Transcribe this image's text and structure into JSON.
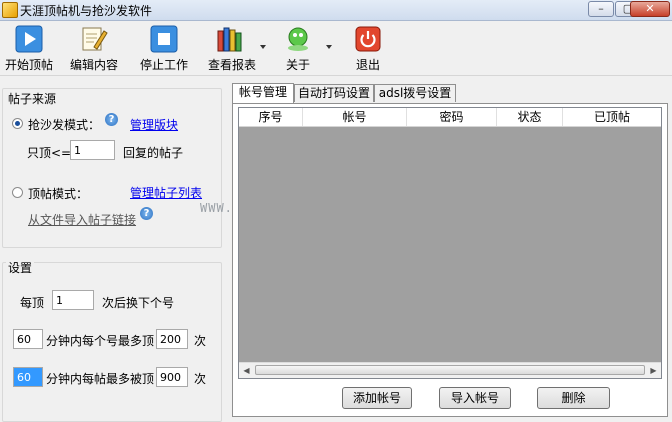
{
  "window": {
    "title": "天涯顶帖机与抢沙发软件",
    "min": "–",
    "max": "▢",
    "close": "✕"
  },
  "toolbar": [
    {
      "label": "开始顶帖",
      "icon": "play-icon"
    },
    {
      "label": "编辑内容",
      "icon": "edit-icon"
    },
    {
      "label": "停止工作",
      "icon": "stop-icon"
    },
    {
      "label": "查看报表",
      "icon": "books-icon"
    },
    {
      "label": "关于",
      "icon": "about-icon"
    },
    {
      "label": "退出",
      "icon": "power-icon"
    }
  ],
  "source": {
    "title": "帖子来源",
    "sofa_mode": "抢沙发模式：",
    "manage_boards": "管理版块",
    "only_top": "只顶<=",
    "only_top_value": "1",
    "replies": "回复的帖子",
    "top_mode": "顶帖模式：",
    "manage_posts": "管理帖子列表",
    "import_link": "从文件导入帖子链接"
  },
  "watermark": "WWW.9UPK.COM",
  "settings": {
    "title": "设置",
    "each_top": "每顶",
    "each_top_value": "1",
    "switch_after": "次后换下个号",
    "minutes1_value": "60",
    "per_account": "分钟内每个号最多顶",
    "per_account_value": "200",
    "times1": "次",
    "minutes2_value": "60",
    "per_post": "分钟内每帖最多被顶",
    "per_post_value": "900",
    "times2": "次"
  },
  "tabs": [
    "帐号管理",
    "自动打码设置",
    "adsl拨号设置"
  ],
  "table": {
    "columns": [
      "序号",
      "帐号",
      "密码",
      "状态",
      "已顶帖"
    ]
  },
  "actions": {
    "add": "添加帐号",
    "import": "导入帐号",
    "delete": "删除"
  }
}
